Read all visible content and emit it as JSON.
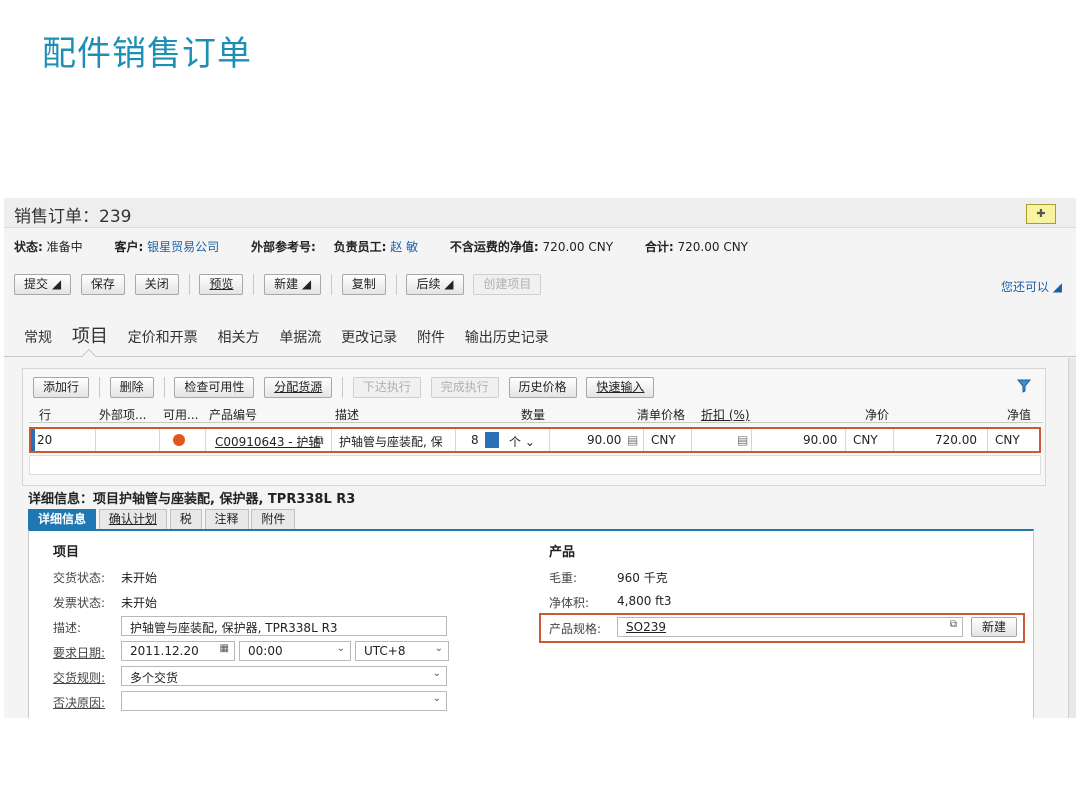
{
  "slide_title": "配件销售订单",
  "window": {
    "title": "销售订单：239"
  },
  "status": {
    "state_label": "状态:",
    "state_value": "准备中",
    "customer_label": "客户:",
    "customer_value": "银星贸易公司",
    "extref_label": "外部参考号:",
    "owner_label": "负责员工:",
    "owner_value": "赵 敏",
    "net_label": "不含运费的净值:",
    "net_value": "720.00  CNY",
    "total_label": "合计:",
    "total_value": "720.00  CNY"
  },
  "toolbar": {
    "submit": "提交",
    "save": "保存",
    "close": "关闭",
    "preview": "预览",
    "new": "新建",
    "copy": "复制",
    "followup": "后续",
    "create_item": "创建项目",
    "you_can_also": "您还可以"
  },
  "tabs": [
    "常规",
    "项目",
    "定价和开票",
    "相关方",
    "单据流",
    "更改记录",
    "附件",
    "输出历史记录"
  ],
  "items_toolbar": {
    "add_row": "添加行",
    "delete": "删除",
    "check_availability": "检查可用性",
    "allocate_source": "分配货源",
    "release": "下达执行",
    "finish": "完成执行",
    "price_history": "历史价格",
    "quick_entry": "快速输入"
  },
  "grid": {
    "headers": {
      "row": "行",
      "ext_item": "外部项...",
      "avail": "可用...",
      "product_id": "产品编号",
      "description": "描述",
      "quantity": "数量",
      "list_price": "清单价格",
      "discount": "折扣 (%)",
      "net_price": "净价",
      "net_value": "净值"
    },
    "row": {
      "row": "20",
      "product_id": "C00910643 - 护轴",
      "description": "护轴管与座装配, 保",
      "quantity": "8",
      "unit": "个",
      "list_price": "90.00",
      "list_currency": "CNY",
      "net_price": "90.00",
      "net_price_currency": "CNY",
      "net_value": "720.00",
      "net_value_currency": "CNY"
    }
  },
  "detail": {
    "title": "详细信息：项目护轴管与座装配, 保护器, TPR338L R3",
    "tabs": [
      "详细信息",
      "确认计划",
      "税",
      "注释",
      "附件"
    ],
    "item_section": "项目",
    "delivery_status_label": "交货状态:",
    "delivery_status_value": "未开始",
    "invoice_status_label": "发票状态:",
    "invoice_status_value": "未开始",
    "description_label": "描述:",
    "description_value": "护轴管与座装配, 保护器, TPR338L R3",
    "req_date_label": "要求日期:",
    "req_date_value": "2011.12.20",
    "req_time_value": "00:00",
    "timezone_value": "UTC+8",
    "delivery_rule_label": "交货规则:",
    "delivery_rule_value": "多个交货",
    "reject_reason_label": "否决原因:",
    "reject_reason_value": "",
    "product_section": "产品",
    "gross_weight_label": "毛重:",
    "gross_weight_value": "960  千克",
    "net_volume_label": "净体积:",
    "net_volume_value": "4,800  ft3",
    "spec_label": "产品规格:",
    "spec_value": "SO239",
    "new_button": "新建"
  }
}
